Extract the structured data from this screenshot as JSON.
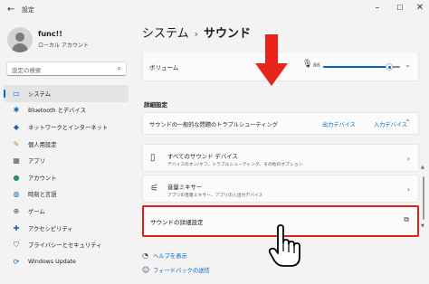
{
  "window": {
    "back_icon": "back-arrow-icon",
    "title": "設定",
    "controls": [
      "minimize-icon",
      "maximize-icon",
      "close-icon"
    ]
  },
  "user": {
    "name": "func!!",
    "account_type": "ローカル アカウント"
  },
  "search": {
    "placeholder": "設定の検索"
  },
  "nav": {
    "active_index": 0,
    "items": [
      {
        "label": "システム",
        "icon": "monitor-icon"
      },
      {
        "label": "Bluetooth とデバイス",
        "icon": "bluetooth-icon"
      },
      {
        "label": "ネットワークとインターネット",
        "icon": "wifi-icon"
      },
      {
        "label": "個人用設定",
        "icon": "brush-icon"
      },
      {
        "label": "アプリ",
        "icon": "apps-icon"
      },
      {
        "label": "アカウント",
        "icon": "person-icon"
      },
      {
        "label": "時刻と言語",
        "icon": "globe-clock-icon"
      },
      {
        "label": "ゲーム",
        "icon": "gamepad-icon"
      },
      {
        "label": "アクセシビリティ",
        "icon": "accessibility-icon"
      },
      {
        "label": "プライバシーとセキュリティ",
        "icon": "shield-icon"
      },
      {
        "label": "Windows Update",
        "icon": "update-icon"
      }
    ]
  },
  "breadcrumb": {
    "parent": "システム",
    "separator": "›",
    "current": "サウンド"
  },
  "volume": {
    "label": "ボリューム",
    "value": "86",
    "level_percent": 86
  },
  "advanced": {
    "section_title": "詳細設定",
    "troubleshoot": {
      "label": "サウンドの一般的な問題のトラブルシューティング",
      "output_link": "出力デバイス",
      "input_link": "入力デバイス"
    },
    "all_devices": {
      "title": "すべてのサウンド デバイス",
      "subtitle": "デバイスのオン/オフ、トラブルシューティング、その他のオプション"
    },
    "mixer": {
      "title": "音量ミキサー",
      "subtitle": "アプリの音量ミキサー、アプリの入出力デバイス"
    },
    "more_settings": {
      "label": "サウンドの詳細設定"
    }
  },
  "footer": {
    "help": "ヘルプを表示",
    "feedback": "フィードバックの送信"
  },
  "colors": {
    "accent": "#0067c0",
    "highlight": "#e0201c",
    "arrow": "#e8231c"
  }
}
